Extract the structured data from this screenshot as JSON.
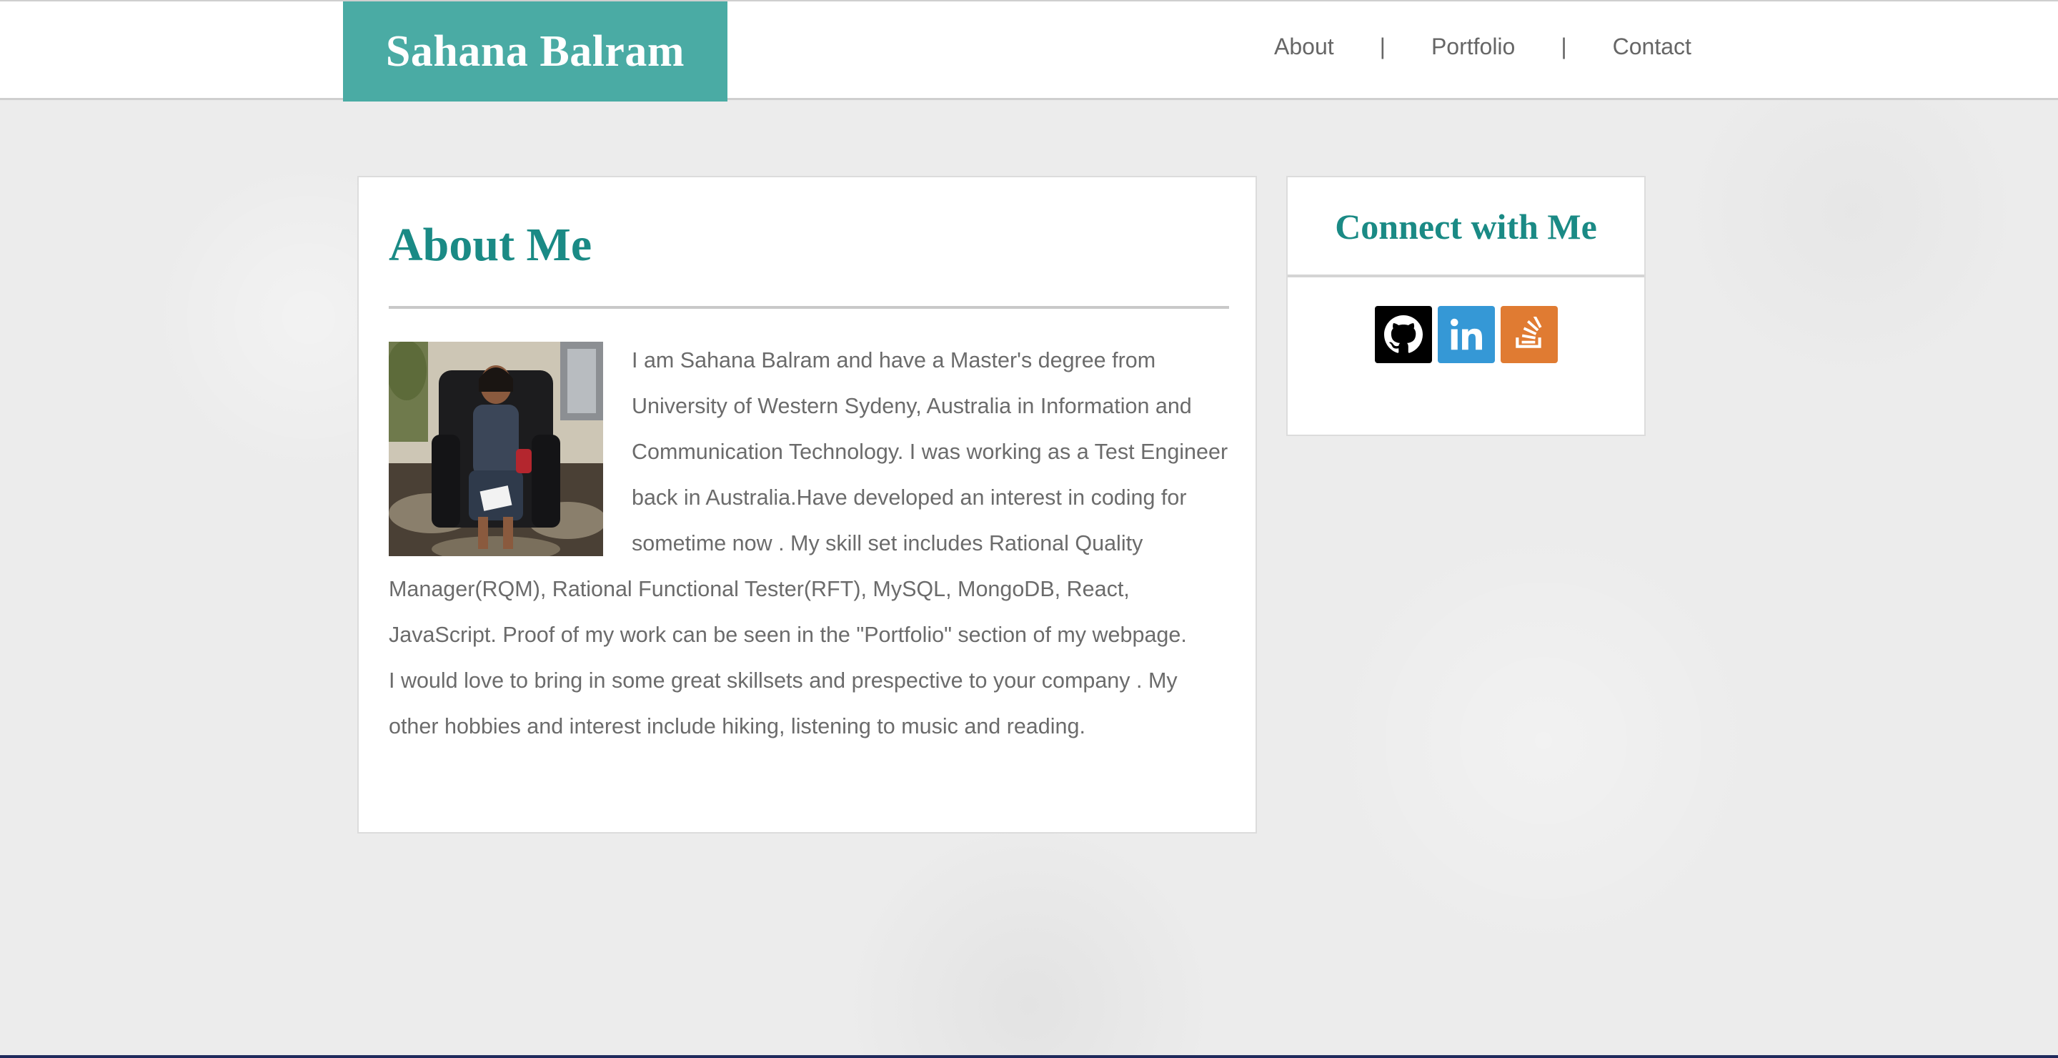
{
  "header": {
    "brand": "Sahana Balram",
    "nav": [
      {
        "label": "About"
      },
      {
        "label": "Portfolio"
      },
      {
        "label": "Contact"
      }
    ],
    "separator": "|"
  },
  "about": {
    "title": "About Me",
    "photo_icon": "profile-photo",
    "paragraphs": [
      "I am Sahana Balram and have a Master's degree from University of Western Sydeny, Australia in Information and Communication Technology. I was working as a Test Engineer back in Australia.Have developed an interest in coding for sometime now . My skill set includes Rational Quality Manager(RQM), Rational Functional Tester(RFT), MySQL, MongoDB, React, JavaScript. Proof of my work can be seen in the \"Portfolio\" section of my webpage.",
      "I would love to bring in some great skillsets and prespective to your company . My other hobbies and interest include hiking, listening to music and reading."
    ]
  },
  "connect": {
    "title": "Connect with Me",
    "links": [
      {
        "icon": "github-icon",
        "color": "#000000"
      },
      {
        "icon": "linkedin-icon",
        "color": "#3598d6"
      },
      {
        "icon": "stackoverflow-icon",
        "color": "#e07b32"
      }
    ]
  },
  "colors": {
    "brand_bg": "#4aaba4",
    "heading": "#1a8a85",
    "body_text": "#6b6b6b",
    "page_bg": "#ececec"
  }
}
